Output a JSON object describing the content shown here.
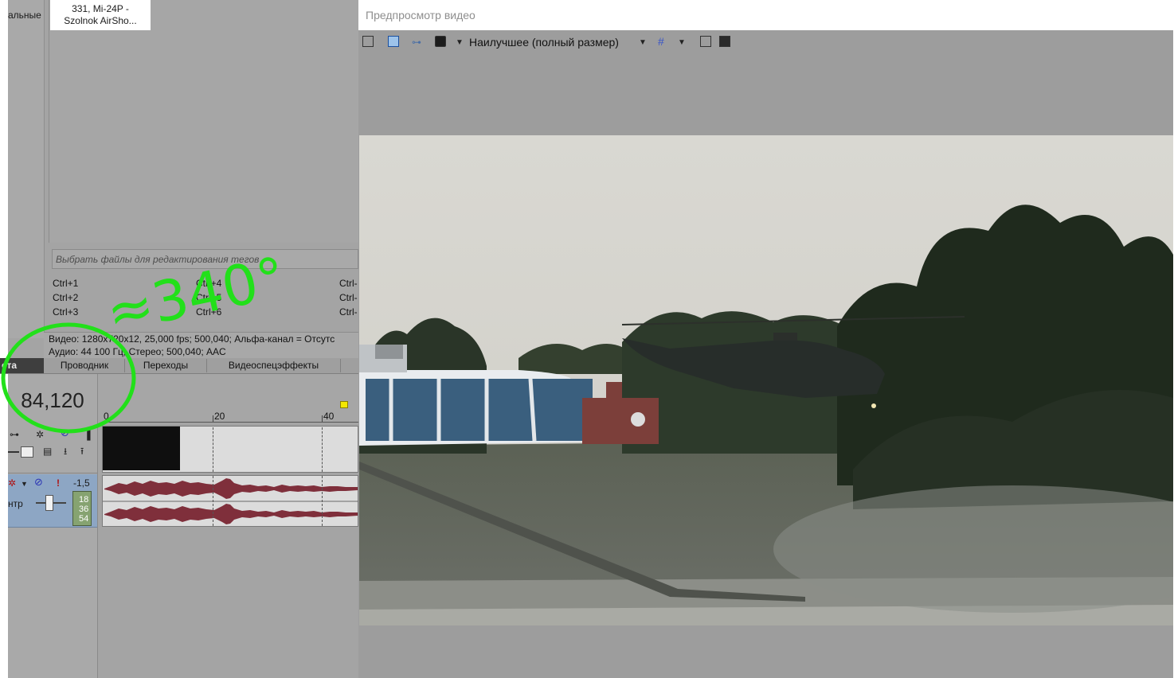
{
  "sidebar": {
    "label": "альные"
  },
  "media": {
    "thumb_title": "331, Mi-24P -\nSzolnok AirSho..."
  },
  "tags": {
    "placeholder": "Выбрать файлы для редактирования тегов",
    "shortcuts_col1": [
      "Ctrl+1",
      "Ctrl+2",
      "Ctrl+3"
    ],
    "shortcuts_col2": [
      "Ctrl+4",
      "Ctrl+5",
      "Ctrl+6"
    ],
    "shortcuts_col3": [
      "Ctrl-",
      "Ctrl-",
      "Ctrl-"
    ]
  },
  "info": {
    "video_line": "Видео: 1280x720x12, 25,000 fps; 500,040; Альфа-канал = Отсутс",
    "audio_line": "Аудио: 44 100 Гц; Стерео; 500,040; AAC"
  },
  "tabs": {
    "active_fragment": "ета",
    "items": [
      "Проводник",
      "Переходы",
      "Видеоспецэффекты"
    ]
  },
  "timeline": {
    "timecode": "84,120",
    "ruler_labels": [
      "0",
      "20",
      "40"
    ],
    "audio_track": {
      "db_value": "-1,5",
      "pan_label": "нтр",
      "meter_values": [
        "18",
        "36",
        "54"
      ]
    }
  },
  "annotation": {
    "handwritten_text": "≈340°",
    "color": "#22e01a"
  },
  "preview": {
    "title": "Предпросмотр видео",
    "quality": "Наилучшее (полный размер)"
  },
  "colors": {
    "panel_gray": "#a4a4a4",
    "audio_header_blue": "#8da6c4",
    "waveform": "#7f2f3b",
    "annotation_green": "#22e01a"
  }
}
